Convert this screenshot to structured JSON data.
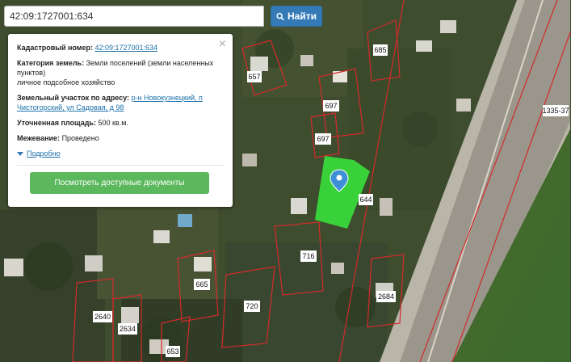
{
  "search": {
    "value": "42:09:1727001:634",
    "button_label": "Найти"
  },
  "info": {
    "cad_label": "Кадастровый номер:",
    "cad_value": "42:09:1727001:634",
    "cat_label": "Категория земель:",
    "cat_value": "Земли поселений (земли населенных пунктов)",
    "use_value": "личное подсобное хозяйство",
    "addr_label": "Земельный участок по адресу:",
    "addr_value": "р-н Новокузнецкий, п Чистогорский, ул Садовая, д 98",
    "area_label": "Уточненная площадь:",
    "area_value": "500 кв.м.",
    "survey_label": "Межевание:",
    "survey_value": "Проведено",
    "more_link": "Подробно",
    "docs_button": "Посмотреть доступные документы"
  },
  "parcels": [
    "657",
    "685",
    "697",
    "697",
    "644",
    "716",
    "665",
    "720",
    "2684",
    "2640",
    "2634",
    "653",
    "1335-37"
  ],
  "colors": {
    "accent": "#337ab7",
    "selected_parcel": "#39e03c",
    "boundary": "#d42a2a",
    "button_green": "#5cb85c"
  }
}
